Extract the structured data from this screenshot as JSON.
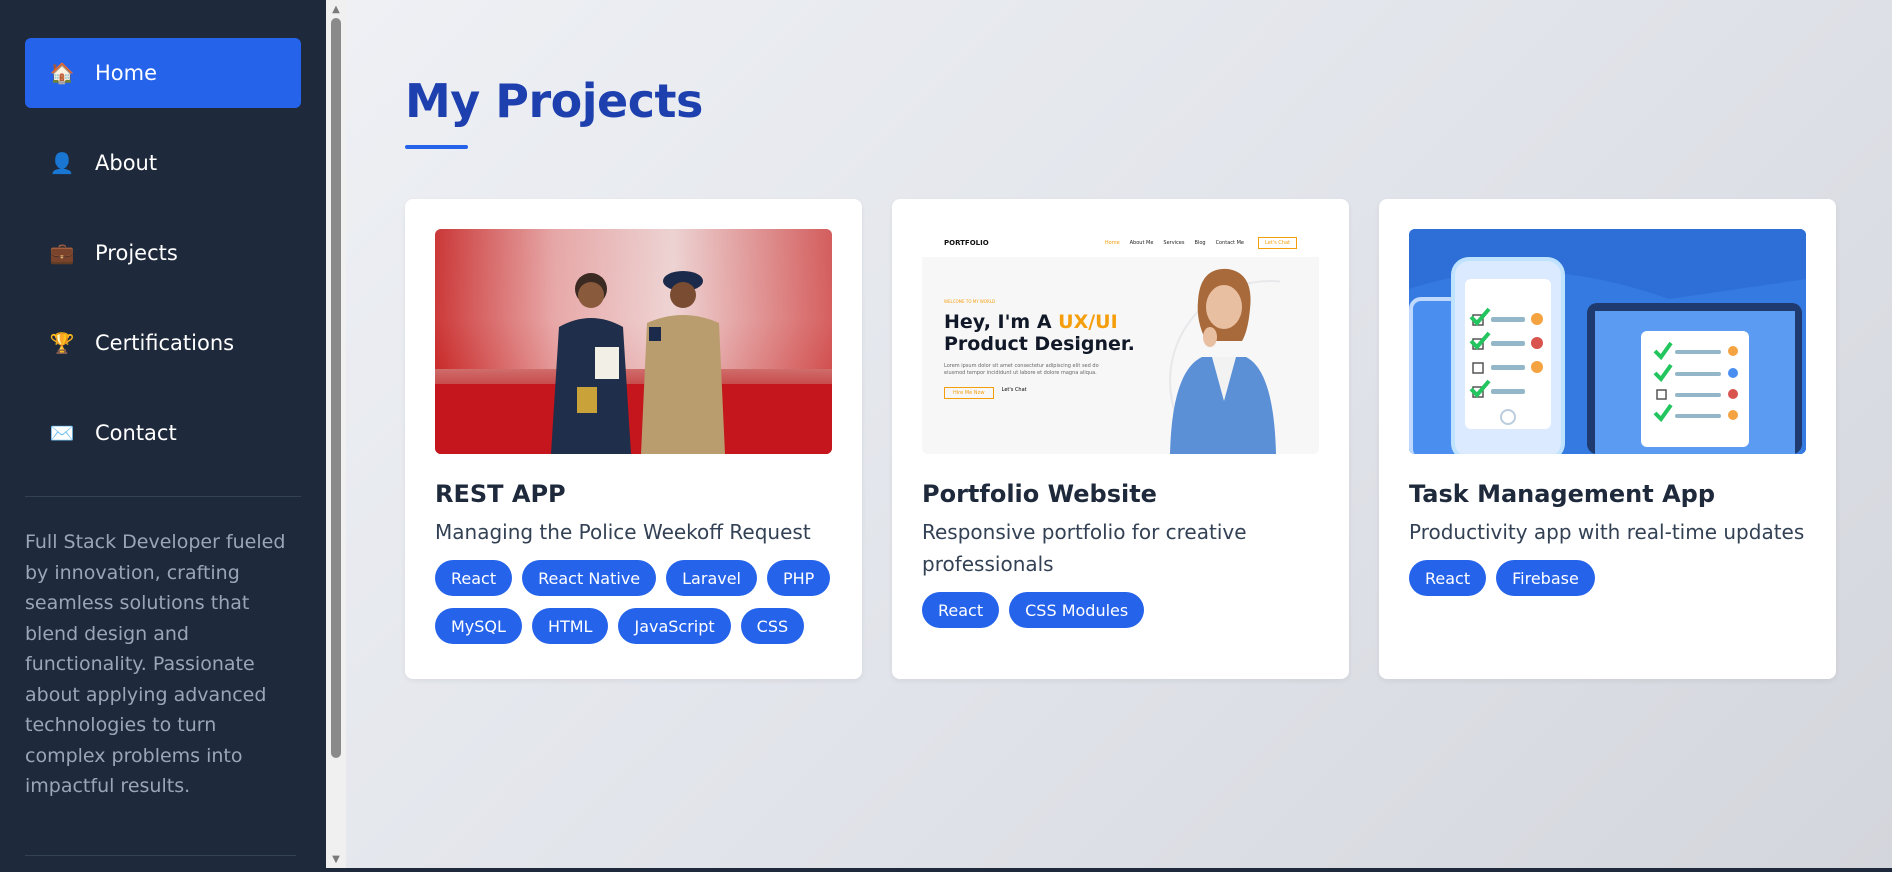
{
  "sidebar": {
    "nav": [
      {
        "label": "Home",
        "icon": "house-icon",
        "glyph": "🏠",
        "active": true
      },
      {
        "label": "About",
        "icon": "person-icon",
        "glyph": "👤",
        "active": false
      },
      {
        "label": "Projects",
        "icon": "briefcase-icon",
        "glyph": "💼",
        "active": false
      },
      {
        "label": "Certifications",
        "icon": "trophy-icon",
        "glyph": "🏆",
        "active": false
      },
      {
        "label": "Contact",
        "icon": "envelope-icon",
        "glyph": "✉️",
        "active": false
      }
    ],
    "bio": "Full Stack Developer fueled by innovation, crafting seamless solutions that blend design and functionality. Passionate about applying advanced technologies to turn complex problems into impactful results."
  },
  "main": {
    "title": "My Projects",
    "projects": [
      {
        "title": "REST APP",
        "description": "Managing the Police Weekoff Request",
        "tags": [
          "React",
          "React Native",
          "Laravel",
          "PHP",
          "MySQL",
          "HTML",
          "JavaScript",
          "CSS"
        ]
      },
      {
        "title": "Portfolio Website",
        "description": "Responsive portfolio for creative professionals",
        "tags": [
          "React",
          "CSS Modules"
        ],
        "preview": {
          "logo": "PORTFOLIO",
          "links": [
            "Home",
            "About Me",
            "Services",
            "Blog",
            "Contact Me"
          ],
          "cta": "Let's Chat",
          "welcome": "WELCOME TO MY WORLD",
          "headline_1": "Hey, I'm A ",
          "headline_accent": "UX/UI",
          "headline_2": "Product Designer.",
          "button_1": "Hire Me Now",
          "button_2": "Let's Chat"
        }
      },
      {
        "title": "Task Management App",
        "description": "Productivity app with real-time updates",
        "tags": [
          "React",
          "Firebase"
        ]
      }
    ]
  },
  "colors": {
    "sidebar_bg": "#1e293b",
    "accent": "#2563eb",
    "title": "#1e40af"
  }
}
